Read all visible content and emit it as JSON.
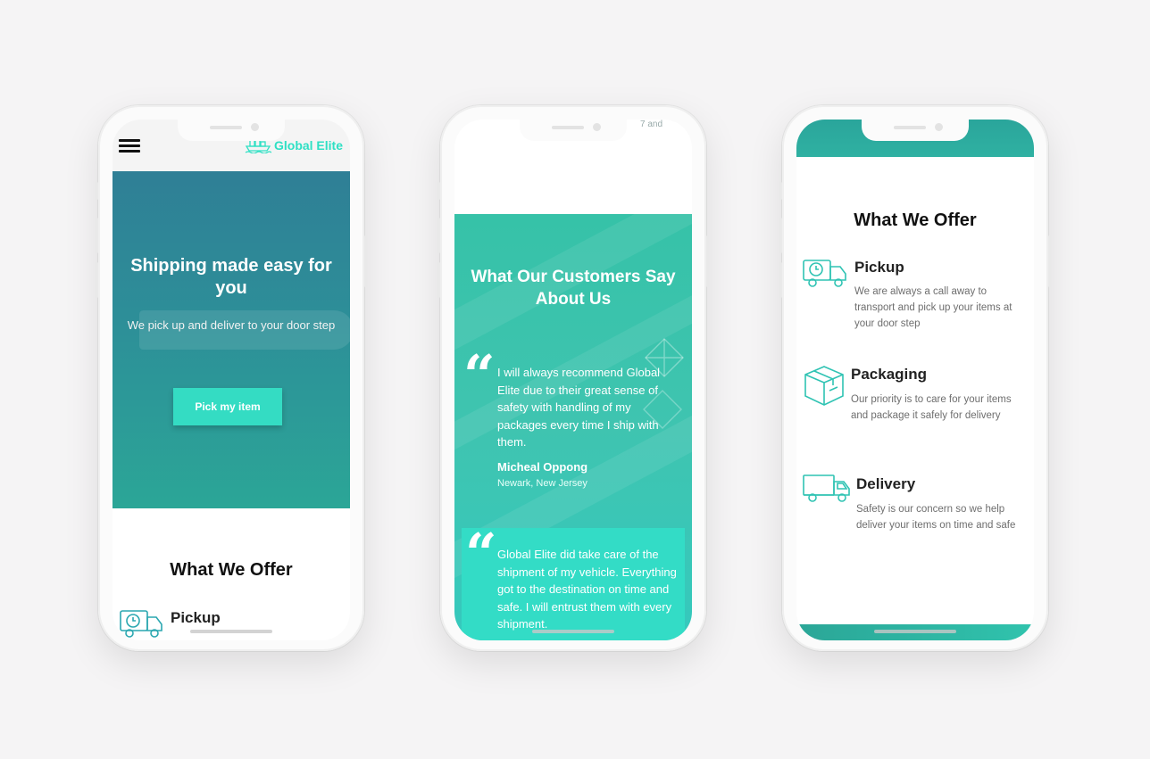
{
  "colors": {
    "background": "#f5f4f5",
    "accent": "#2ee0c4",
    "hero_teal": "#2d8f98",
    "button": "#34dcc3",
    "text_dark": "#111111",
    "text_muted": "#6e6e6e"
  },
  "phone1": {
    "logo_text": "Global Elite",
    "hero": {
      "heading": "Shipping made easy for you",
      "subheading": "We pick up and deliver to your door step",
      "cta_label": "Pick my item"
    },
    "section_title": "What We Offer",
    "offer_first": "Pickup"
  },
  "phone2": {
    "clipped_text": "7 and",
    "heading": "What Our Customers Say About Us",
    "testimonials": [
      {
        "text": "I will always recommend Global Elite due to their great sense of safety with handling of my packages every time I ship with them.",
        "author": "Micheal Oppong",
        "location": "Newark, New Jersey"
      },
      {
        "text": "Global Elite did take care of the shipment of my vehicle. Everything got to the destination on time and safe. I will entrust them with every shipment."
      }
    ]
  },
  "phone3": {
    "section_title": "What We Offer",
    "offers": [
      {
        "title": "Pickup",
        "desc": "We are always a call away to transport and pick up your items at your door step",
        "icon": "truck-clock-icon"
      },
      {
        "title": "Packaging",
        "desc": "Our priority is to care for your items and package it safely for delivery",
        "icon": "package-box-icon"
      },
      {
        "title": "Delivery",
        "desc": "Safety is our concern so we help deliver your items on time and safe",
        "icon": "delivery-truck-icon"
      }
    ]
  }
}
